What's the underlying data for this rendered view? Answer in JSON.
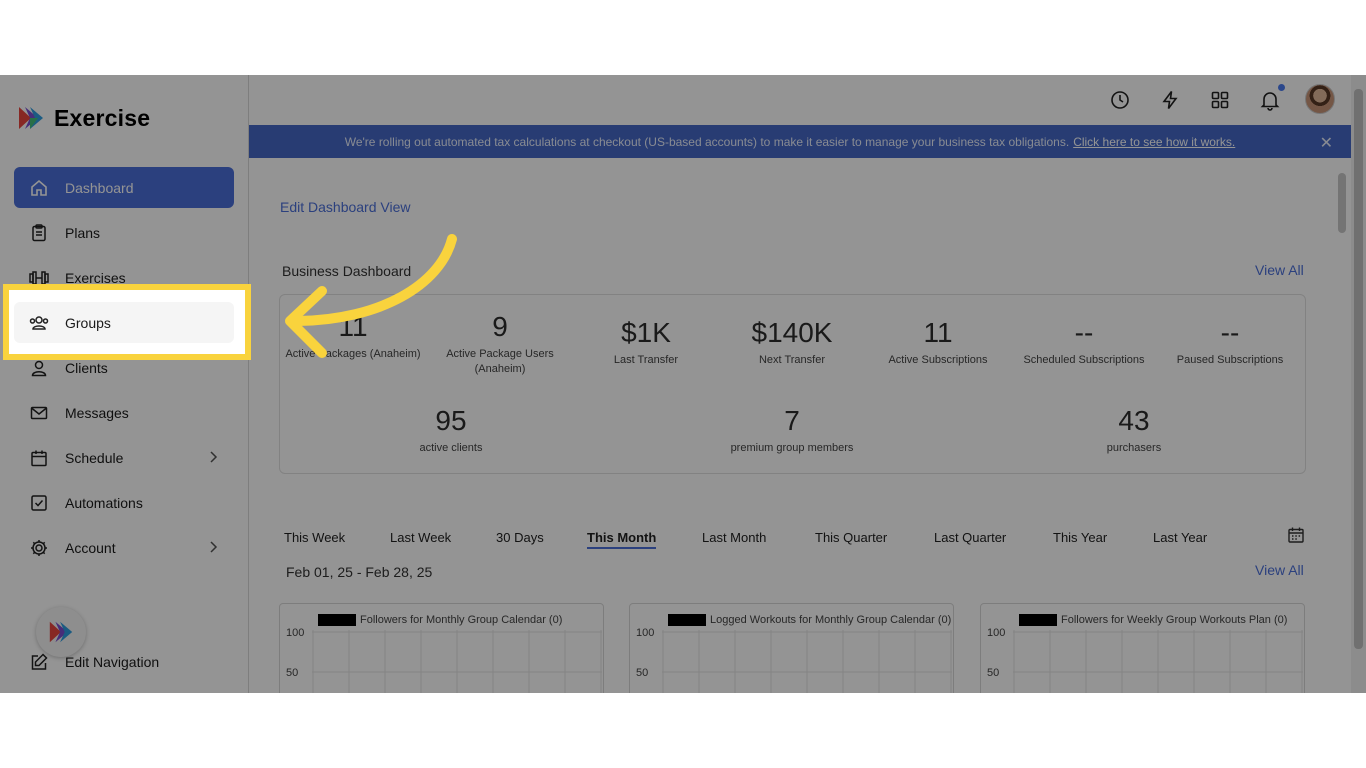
{
  "brand": {
    "name": "Exercise"
  },
  "sidebar": {
    "items": [
      {
        "label": "Dashboard",
        "icon": "home-icon"
      },
      {
        "label": "Plans",
        "icon": "clipboard-icon"
      },
      {
        "label": "Exercises",
        "icon": "dumbbell-icon"
      },
      {
        "label": "Groups",
        "icon": "users-icon"
      },
      {
        "label": "Clients",
        "icon": "user-icon"
      },
      {
        "label": "Messages",
        "icon": "mail-icon"
      },
      {
        "label": "Schedule",
        "icon": "calendar-icon"
      },
      {
        "label": "Automations",
        "icon": "checkbox-icon"
      },
      {
        "label": "Account",
        "icon": "gear-icon"
      }
    ],
    "edit_navigation": "Edit Navigation"
  },
  "banner": {
    "text": "We're rolling out automated tax calculations at checkout (US-based accounts) to make it easier to manage your business tax obligations.",
    "link": "Click here to see how it works.",
    "close": "✕"
  },
  "main": {
    "edit_dashboard": "Edit Dashboard View",
    "business_dashboard": "Business Dashboard",
    "view_all": "View All",
    "stats_row1": [
      {
        "value": "11",
        "label": "Active Packages (Anaheim)"
      },
      {
        "value": "9",
        "label": "Active Package Users (Anaheim)"
      },
      {
        "value": "$1K",
        "label": "Last Transfer"
      },
      {
        "value": "$140K",
        "label": "Next Transfer"
      },
      {
        "value": "11",
        "label": "Active Subscriptions"
      },
      {
        "value": "--",
        "label": "Scheduled Subscriptions"
      },
      {
        "value": "--",
        "label": "Paused Subscriptions"
      }
    ],
    "stats_row2": [
      {
        "value": "95",
        "label": "active clients"
      },
      {
        "value": "7",
        "label": "premium group members"
      },
      {
        "value": "43",
        "label": "purchasers"
      }
    ],
    "tabs": [
      "This Week",
      "Last Week",
      "30 Days",
      "This Month",
      "Last Month",
      "This Quarter",
      "Last Quarter",
      "This Year",
      "Last Year"
    ],
    "active_tab": "This Month",
    "date_range": "Feb 01, 25 - Feb 28, 25",
    "view_all_2": "View All",
    "charts": [
      {
        "legend": "Followers for Monthly Group Calendar (0)",
        "y_ticks": [
          "100",
          "50"
        ]
      },
      {
        "legend": "Logged Workouts for Monthly Group Calendar (0)",
        "y_ticks": [
          "100",
          "50"
        ]
      },
      {
        "legend": "Followers for Weekly Group Workouts Plan (0)",
        "y_ticks": [
          "100",
          "50"
        ]
      }
    ]
  },
  "chart_data": [
    {
      "type": "line",
      "series": [
        {
          "name": "Followers for Monthly Group Calendar (0)",
          "values": []
        }
      ],
      "ylim": [
        0,
        100
      ],
      "yticks": [
        100,
        50
      ]
    },
    {
      "type": "line",
      "series": [
        {
          "name": "Logged Workouts for Monthly Group Calendar (0)",
          "values": []
        }
      ],
      "ylim": [
        0,
        100
      ],
      "yticks": [
        100,
        50
      ]
    },
    {
      "type": "line",
      "series": [
        {
          "name": "Followers for Weekly Group Workouts Plan (0)",
          "values": []
        }
      ],
      "ylim": [
        0,
        100
      ],
      "yticks": [
        100,
        50
      ]
    }
  ],
  "colors": {
    "accent": "#4b6fd9",
    "banner": "#4568c7",
    "highlight": "#f9d33d"
  }
}
